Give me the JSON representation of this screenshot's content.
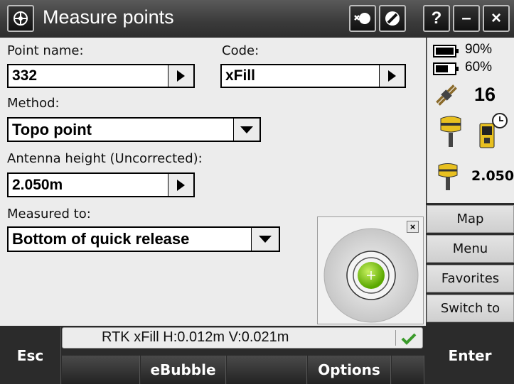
{
  "title": "Measure points",
  "title_buttons": {
    "help": "?",
    "minimize": "–",
    "close": "×"
  },
  "form": {
    "point_name_label": "Point name:",
    "point_name_value": "332",
    "code_label": "Code:",
    "code_value": "xFill",
    "method_label": "Method:",
    "method_value": "Topo point",
    "antenna_label": "Antenna height (Uncorrected):",
    "antenna_value": "2.050m",
    "measured_to_label": "Measured to:",
    "measured_to_value": "Bottom of quick release"
  },
  "status": {
    "battery1": "90%",
    "battery2": "60%",
    "satellites": "16",
    "antenna_height": "2.050"
  },
  "side_buttons": {
    "map": "Map",
    "menu": "Menu",
    "favorites": "Favorites",
    "switch_to": "Switch to"
  },
  "status_line": "RTK xFill H:0.012m V:0.021m",
  "softkeys": {
    "esc": "Esc",
    "ebubble": "eBubble",
    "options": "Options",
    "enter": "Enter"
  },
  "colors": {
    "accent_green": "#7ac70c",
    "check_green": "#3a9a2a"
  }
}
